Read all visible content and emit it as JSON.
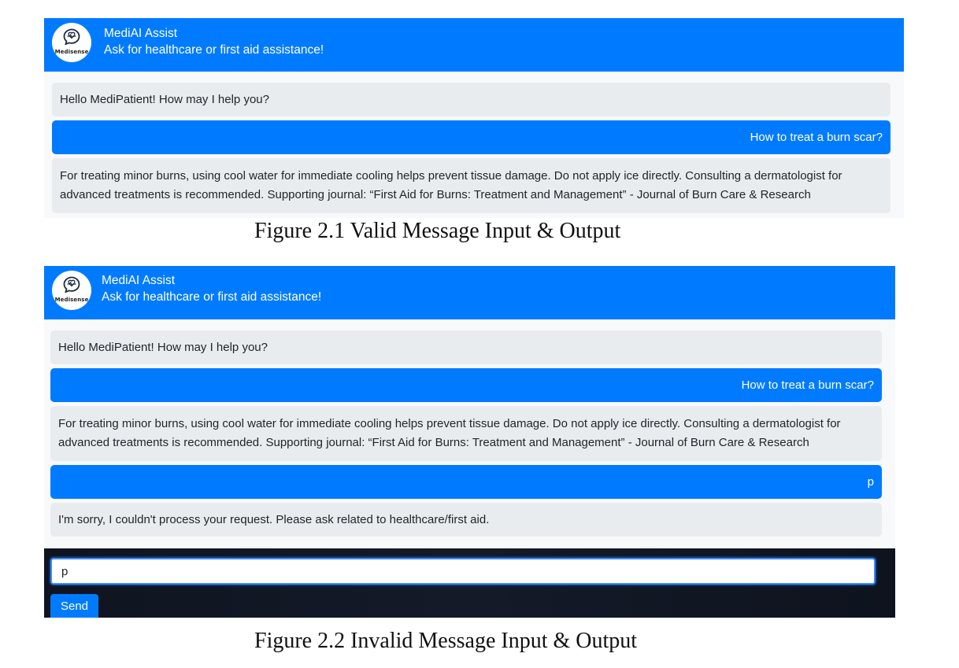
{
  "figure1": {
    "header": {
      "logo_text": "Medisense",
      "title": "MediAI Assist",
      "subtitle": "Ask for healthcare or first aid assistance!"
    },
    "messages": [
      {
        "role": "bot",
        "text": "Hello MediPatient! How may I help you?"
      },
      {
        "role": "user",
        "text": "How to treat a burn scar?"
      },
      {
        "role": "bot",
        "text": "For treating minor burns, using cool water for immediate cooling helps prevent tissue damage. Do not apply ice directly. Consulting a dermatologist for advanced treatments is recommended. Supporting journal: “First Aid for Burns: Treatment and Management” - Journal of Burn Care & Research"
      }
    ],
    "caption": "Figure 2.1 Valid Message Input & Output"
  },
  "figure2": {
    "header": {
      "logo_text": "Medisense",
      "title": "MediAI Assist",
      "subtitle": "Ask for healthcare or first aid assistance!"
    },
    "messages": [
      {
        "role": "bot",
        "text": "Hello MediPatient! How may I help you?"
      },
      {
        "role": "user",
        "text": "How to treat a burn scar?"
      },
      {
        "role": "bot",
        "text": "For treating minor burns, using cool water for immediate cooling helps prevent tissue damage. Do not apply ice directly. Consulting a dermatologist for advanced treatments is recommended. Supporting journal: “First Aid for Burns: Treatment and Management” - Journal of Burn Care & Research"
      },
      {
        "role": "user",
        "text": "p"
      },
      {
        "role": "bot",
        "text": "I'm sorry, I couldn't process your request. Please ask related to healthcare/first aid."
      }
    ],
    "input": {
      "value": "p"
    },
    "send_label": "Send",
    "caption": "Figure 2.2 Invalid Message Input & Output"
  },
  "colors": {
    "header_blue": "#007bff",
    "bot_bubble": "#e9ecef",
    "user_bubble": "#007bff",
    "panel_bg": "#f8f9fa",
    "input_bar": "#111827"
  },
  "icons": {
    "logo": "heartbeat-chat-bubble-icon"
  }
}
